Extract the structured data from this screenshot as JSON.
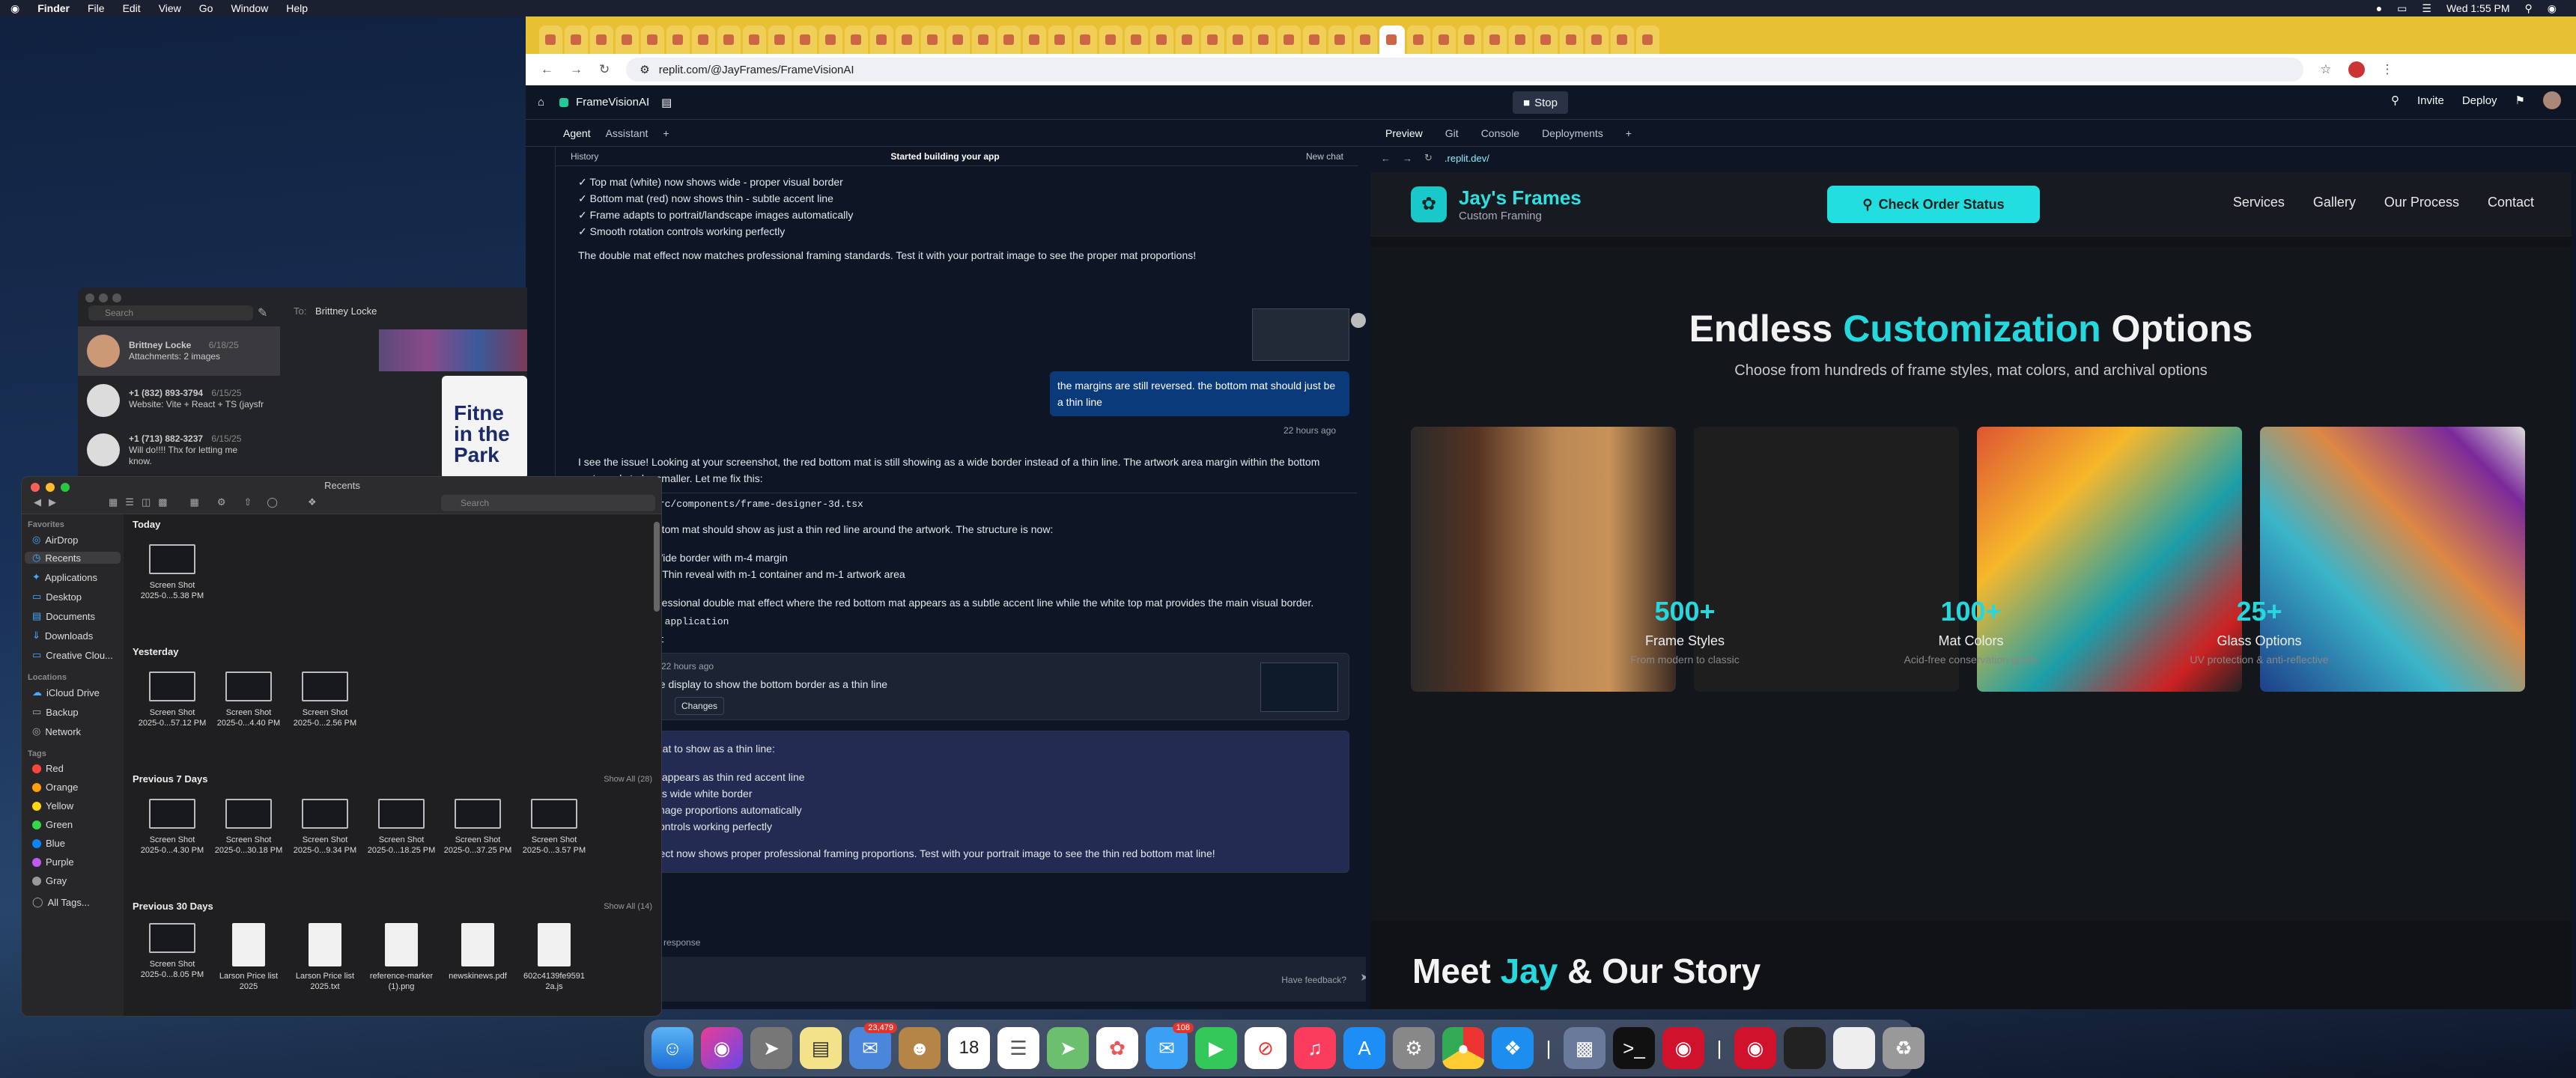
{
  "menubar": {
    "apple": "",
    "items": [
      "Finder",
      "File",
      "Edit",
      "View",
      "Go",
      "Window",
      "Help"
    ],
    "clock": "Wed 1:55 PM"
  },
  "browser": {
    "url": "replit.com/@JayFrames/FrameVisionAI",
    "tab_count_visible": 44
  },
  "replit": {
    "project": "FrameVisionAI",
    "stop": "Stop",
    "invite": "Invite",
    "deploy": "Deploy",
    "left_tabs": [
      "Agent",
      "Assistant"
    ],
    "right_tabs": [
      "Preview",
      "Git",
      "Console",
      "Deployments"
    ],
    "preview_url": ".replit.dev/",
    "chat": {
      "history": "History",
      "status": "Started building your app",
      "new_chat": "New chat",
      "lines_top": [
        "✓ Top mat (white) now shows wide - proper visual border",
        "✓ Bottom mat (red) now shows thin - subtle accent line",
        "✓ Frame adapts to portrait/landscape images automatically",
        "✓ Smooth rotation controls working perfectly"
      ],
      "para1": "The double mat effect now matches professional framing standards. Test it with your portrait image to see the proper mat proportions!",
      "user_msg": "the margins are still reversed. the bottom mat should just be a thin line",
      "user_time": "22 hours ago",
      "reply1": "I see the issue! Looking at your screenshot, the red bottom mat is still showing as a wide border instead of a thin line. The artwork area margin within the bottom",
      "reply1b": "mat needs to be smaller. Let me fix this:",
      "file": "src/components/frame-designer-3d.tsx",
      "reply2": "ottom mat should show as just a thin red line around the artwork. The structure is now:",
      "b1": "Wide border with m-4 margin",
      "b2": "): Thin reveal with m-1 container and m-1 artwork area",
      "reply3": "ofessional double mat effect where the red bottom mat appears as a subtle accent line while the white top mat provides the main visual border.",
      "app_line": "t application",
      "shot_line": "ot",
      "checkpoint_time": "e 22 hours ago",
      "checkpoint": "ne display to show the bottom border as a thin line",
      "rollback": "re",
      "changes": "Changes",
      "summary_title": "mat to show as a thin line:",
      "s1": "v appears as thin red accent line",
      "s2": "ins wide white border",
      "s3": "image proportions automatically",
      "s4": "controls working perfectly",
      "s5": "ffect now shows proper professional framing proportions. Test with your portrait image to see the thin red bottom mat line!",
      "response": "ur response",
      "feedback": "Have feedback?"
    }
  },
  "site": {
    "brand": "Jay's Frames",
    "sub": "Custom Framing",
    "order_btn": "Check Order Status",
    "nav": [
      "Services",
      "Gallery",
      "Our Process",
      "Contact"
    ],
    "headline_a": "Endless ",
    "headline_b": "Customization",
    "headline_c": " Options",
    "headline_sub": "Choose from hundreds of frame styles, mat colors, and archival options",
    "stats": [
      {
        "num": "500+",
        "label": "Frame Styles",
        "sub": "From modern to classic"
      },
      {
        "num": "100+",
        "label": "Mat Colors",
        "sub": "Acid-free conservation grade"
      },
      {
        "num": "25+",
        "label": "Glass Options",
        "sub": "UV protection & anti-reflective"
      }
    ],
    "meet_a": "Meet ",
    "meet_b": "Jay",
    "meet_c": " & Our Story"
  },
  "messages": {
    "search": "Search",
    "to_label": "To:",
    "to": "Brittney Locke",
    "convos": [
      {
        "name": "Brittney Locke",
        "date": "6/18/25",
        "preview": "Attachments: 2 images"
      },
      {
        "name": "+1 (832) 893-3794",
        "date": "6/15/25",
        "preview": "Website: Vite + React + TS (jaysframedesignerwithoma.netl..."
      },
      {
        "name": "+1 (713) 882-3237",
        "date": "6/15/25",
        "preview": "Will do!!!! Thx for letting me know."
      }
    ],
    "poster": "Fitne in the Park"
  },
  "finder": {
    "title": "Recents",
    "search": "Search",
    "favorites_h": "Favorites",
    "favorites": [
      "AirDrop",
      "Recents",
      "Applications",
      "Desktop",
      "Documents",
      "Downloads",
      "Creative Clou..."
    ],
    "locations_h": "Locations",
    "locations": [
      "iCloud Drive",
      "Backup",
      "Network"
    ],
    "tags_h": "Tags",
    "tags": [
      {
        "name": "Red",
        "color": "#ff453a"
      },
      {
        "name": "Orange",
        "color": "#ff9f0a"
      },
      {
        "name": "Yellow",
        "color": "#ffd60a"
      },
      {
        "name": "Green",
        "color": "#32d74b"
      },
      {
        "name": "Blue",
        "color": "#0a84ff"
      },
      {
        "name": "Purple",
        "color": "#bf5af2"
      },
      {
        "name": "Gray",
        "color": "#98989d"
      }
    ],
    "all_tags": "All Tags...",
    "groups": {
      "today": "Today",
      "yesterday": "Yesterday",
      "prev7": "Previous 7 Days",
      "prev7_show": "Show All (28)",
      "prev30": "Previous 30 Days",
      "prev30_show": "Show All (14)"
    },
    "today_items": [
      {
        "a": "Screen Shot",
        "b": "2025-0...5.38 PM"
      }
    ],
    "yesterday_items": [
      {
        "a": "Screen Shot",
        "b": "2025-0...57.12 PM"
      },
      {
        "a": "Screen Shot",
        "b": "2025-0...4.40 PM"
      },
      {
        "a": "Screen Shot",
        "b": "2025-0...2.56 PM"
      }
    ],
    "prev7_items": [
      {
        "a": "Screen Shot",
        "b": "2025-0...4.30 PM"
      },
      {
        "a": "Screen Shot",
        "b": "2025-0...30.18 PM"
      },
      {
        "a": "Screen Shot",
        "b": "2025-0...9.34 PM"
      },
      {
        "a": "Screen Shot",
        "b": "2025-0...18.25 PM"
      },
      {
        "a": "Screen Shot",
        "b": "2025-0...37.25 PM"
      },
      {
        "a": "Screen Shot",
        "b": "2025-0...3.57 PM"
      }
    ],
    "prev30_items": [
      {
        "a": "Screen Shot",
        "b": "2025-0...8.05 PM"
      },
      {
        "a": "Larson Price list",
        "b": "2025"
      },
      {
        "a": "Larson Price list",
        "b": "2025.txt"
      },
      {
        "a": "reference-marker",
        "b": "(1).png"
      },
      {
        "a": "newskinews.pdf",
        "b": ""
      },
      {
        "a": "602c4139fe9591",
        "b": "2a.js"
      }
    ]
  },
  "dock": {
    "mail_badge": "23,479",
    "messages_badge": "108",
    "calendar_day": "18"
  }
}
